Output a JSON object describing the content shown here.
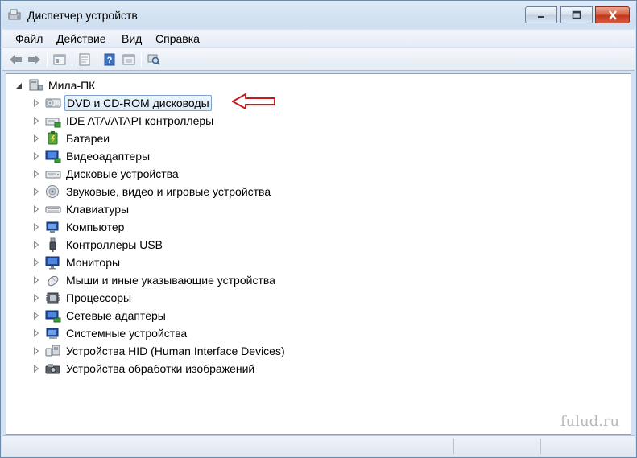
{
  "window": {
    "title": "Диспетчер устройств"
  },
  "menu": {
    "file": "Файл",
    "action": "Действие",
    "view": "Вид",
    "help": "Справка"
  },
  "toolbar": {
    "icons": [
      "back-arrow-icon",
      "forward-arrow-icon",
      "show-hide-tree-icon",
      "properties-icon",
      "help-icon",
      "update-driver-icon",
      "scan-hardware-icon"
    ]
  },
  "tree": {
    "root": "Мила-ПК",
    "items": [
      {
        "label": "DVD и CD-ROM дисководы",
        "icon": "dvd-drive-icon"
      },
      {
        "label": "IDE ATA/ATAPI контроллеры",
        "icon": "ide-controller-icon"
      },
      {
        "label": "Батареи",
        "icon": "battery-icon"
      },
      {
        "label": "Видеоадаптеры",
        "icon": "display-adapter-icon"
      },
      {
        "label": "Дисковые устройства",
        "icon": "disk-drive-icon"
      },
      {
        "label": "Звуковые, видео и игровые устройства",
        "icon": "sound-device-icon"
      },
      {
        "label": "Клавиатуры",
        "icon": "keyboard-icon"
      },
      {
        "label": "Компьютер",
        "icon": "computer-icon"
      },
      {
        "label": "Контроллеры USB",
        "icon": "usb-icon"
      },
      {
        "label": "Мониторы",
        "icon": "monitor-icon"
      },
      {
        "label": "Мыши и иные указывающие устройства",
        "icon": "mouse-icon"
      },
      {
        "label": "Процессоры",
        "icon": "processor-icon"
      },
      {
        "label": "Сетевые адаптеры",
        "icon": "network-adapter-icon"
      },
      {
        "label": "Системные устройства",
        "icon": "system-device-icon"
      },
      {
        "label": "Устройства HID (Human Interface Devices)",
        "icon": "hid-icon"
      },
      {
        "label": "Устройства обработки изображений",
        "icon": "imaging-device-icon"
      }
    ]
  },
  "watermark": "fulud.ru",
  "colors": {
    "annotation_arrow": "#c8191e",
    "selection_border": "#7da2ce"
  }
}
